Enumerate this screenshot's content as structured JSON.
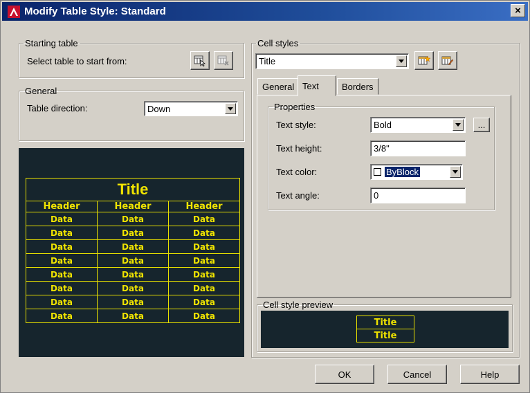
{
  "window": {
    "title": "Modify Table Style: Standard",
    "close_glyph": "×"
  },
  "starting_table": {
    "legend": "Starting table",
    "select_label": "Select table to start from:",
    "icons": [
      "select-table-icon",
      "delete-table-icon"
    ]
  },
  "general": {
    "legend": "General",
    "direction_label": "Table direction:",
    "direction_value": "Down"
  },
  "preview": {
    "title": "Title",
    "headers": [
      "Header",
      "Header",
      "Header"
    ],
    "rows": [
      [
        "Data",
        "Data",
        "Data"
      ],
      [
        "Data",
        "Data",
        "Data"
      ],
      [
        "Data",
        "Data",
        "Data"
      ],
      [
        "Data",
        "Data",
        "Data"
      ],
      [
        "Data",
        "Data",
        "Data"
      ],
      [
        "Data",
        "Data",
        "Data"
      ],
      [
        "Data",
        "Data",
        "Data"
      ],
      [
        "Data",
        "Data",
        "Data"
      ]
    ],
    "colors": {
      "background": "#16252d",
      "text": "#f0e400",
      "lines": "#e8e000"
    }
  },
  "cell_styles": {
    "legend": "Cell styles",
    "selected": "Title",
    "icons": [
      "create-cell-style-icon",
      "manage-cell-styles-icon"
    ],
    "tabs": [
      {
        "label": "General",
        "active": false
      },
      {
        "label": "Text",
        "active": true
      },
      {
        "label": "Borders",
        "active": false
      }
    ]
  },
  "properties": {
    "legend": "Properties",
    "text_style_label": "Text style:",
    "text_style_value": "Bold",
    "browse_label": "...",
    "text_height_label": "Text height:",
    "text_height_value": "3/8\"",
    "text_color_label": "Text color:",
    "text_color_value": "ByBlock",
    "text_angle_label": "Text angle:",
    "text_angle_value": "0"
  },
  "cell_style_preview": {
    "legend": "Cell style preview",
    "rows": [
      "Title",
      "Title"
    ]
  },
  "buttons": {
    "ok": "OK",
    "cancel": "Cancel",
    "help": "Help"
  }
}
